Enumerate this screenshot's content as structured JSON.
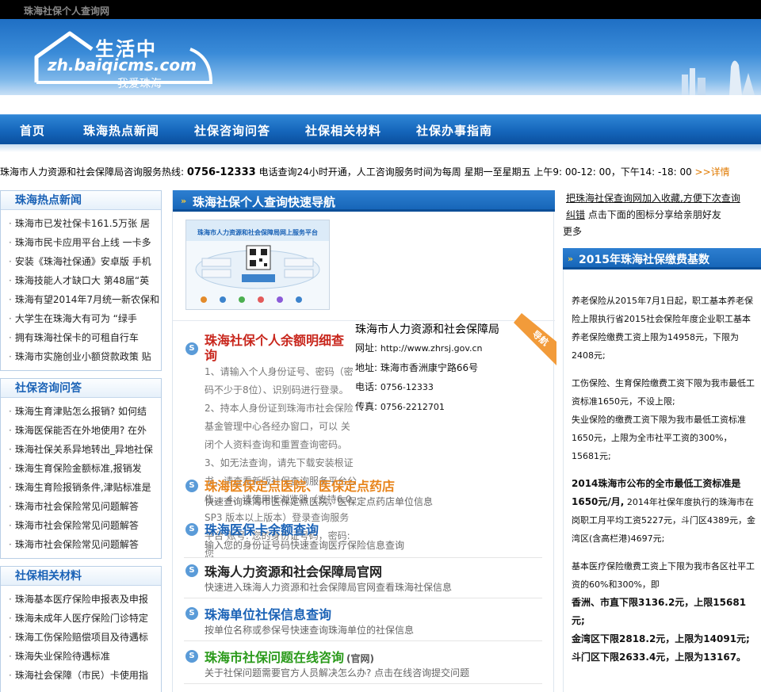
{
  "topbar": {
    "site_name": "珠海社保个人查询网"
  },
  "logo": {
    "top": "生活中",
    "url": "zh.baiqicms.com",
    "sub": "我爱珠海"
  },
  "nav": {
    "items": [
      "首页",
      "珠海热点新闻",
      "社保咨询问答",
      "社保相关材料",
      "社保办事指南"
    ]
  },
  "hotline": {
    "prefix": "珠海市人力资源和社会保障局咨询服务热线: ",
    "number": "0756-12333",
    "text": " 电话查询24小时开通，人工咨询服务时间为每周 星期一至星期五 上午9: 00-12: 00，下午14: -18: 00 ",
    "more": ">>详情"
  },
  "left": {
    "news": {
      "title": "珠海热点新闻",
      "items": [
        "珠海市已发社保卡161.5万张 居",
        "珠海市民卡应用平台上线 一卡多",
        "安装《珠海社保通》安卓版 手机",
        "珠海技能人才缺口大 第48届“英",
        "珠海有望2014年7月统一新农保和",
        "大学生在珠海大有可为 “绿手",
        "拥有珠海社保卡的可租自行车",
        "珠海市实施创业小额贷款政策 贴"
      ]
    },
    "qa": {
      "title": "社保咨询问答",
      "items": [
        "珠海生育津贴怎么报销? 如何结",
        "珠海医保能否在外地使用? 在外",
        "珠海社保关系异地转出_异地社保",
        "珠海生育保险金额标准,报销发",
        "珠海生育险报销条件,津贴标准是",
        "珠海市社会保险常见问题解答",
        "珠海市社会保险常见问题解答",
        "珠海市社会保险常见问题解答"
      ]
    },
    "materials": {
      "title": "社保相关材料",
      "items": [
        "珠海基本医疗保险申报表及申报",
        "珠海未成年人医疗保险门诊特定",
        "珠海工伤保险赔偿项目及待遇标",
        "珠海失业保险待遇标准",
        "珠海社会保障（市民）卡使用指"
      ]
    }
  },
  "mid": {
    "header": "珠海社保个人查询快速导航",
    "ribbon": "导航",
    "thumb_title": "珠海市人力资源和社会保障局网上服务平台",
    "balance": {
      "title": "珠海社保个人余额明细查询",
      "desc": "1、请输入个人身份证号、密码（密码不少于8位）、识别码进行登录。 2、持本人身份证到珠海市社会保险基金管理中心各经办窗口，可以 关闭个人资料查询和重置查询密码。 3、如无法查询，请先下载安装根证书，请查看新版社保查询服务平台公告。 4、请使用IE浏览器（支持6.0 SP3 版本以上版本）登录查询服务 平台 账号: 您的身份证号码，密码: 您"
    },
    "org": {
      "name": "珠海市人力资源和社会保障局",
      "website_label": "网址:",
      "website": "http://www.zhrsj.gov.cn",
      "address_label": "地址:",
      "address": "珠海市香洲康宁路66号",
      "phone_label": "电话:",
      "phone": "0756-12333",
      "fax_label": "传真:",
      "fax": "0756-2212701"
    },
    "entries": [
      {
        "title": "珠海医保定点医院、医保定点药店",
        "desc": "快速查询珠海市医保定点医院，医保定点药店单位信息",
        "color": "#e8851c"
      },
      {
        "title": "珠海医保卡余额查询",
        "desc": "输入您的身份证号码快速查询医疗保险信息查询",
        "color": "#1a62b6"
      },
      {
        "title": "珠海人力资源和社会保障局官网",
        "desc": "快速进入珠海人力资源和社会保障局官网查看珠海社保信息",
        "color": "#222222"
      },
      {
        "title": "珠海单位社保信息查询",
        "desc": "按单位名称或参保号快速查询珠海单位的社保信息",
        "color": "#1a62b6"
      },
      {
        "title": "珠海市社保问题在线咨询",
        "tag": "(官网)",
        "desc": "关于社保问题需要官方人员解决怎么办? 点击在线咨询提交问题",
        "color": "#2a9a1a"
      }
    ]
  },
  "right": {
    "bookmark": "把珠海社保查询网加入收藏,方便下次查询",
    "share_a": "纠错",
    "share_b": "点击下面的图标分享给亲朋好友",
    "share_c": "更多",
    "header": "2015年珠海社保缴费基数",
    "p1": "养老保险从2015年7月1日起，职工基本养老保险上限执行省2015社会保险年度企业职工基本养老保险缴费工资上限为14958元，下限为2408元;",
    "p2a": "工伤保险、生育保险缴费工资下限为我市最低工资标准1650元，不设上限;",
    "p2b": "失业保险的缴费工资下限为我市最低工资标准1650元，上限为全市社平工资的300%，15681元;",
    "p3_bold": "2014珠海市公布的全市最低工资标准是1650元/月,",
    "p3": " 2014年社保年度执行的珠海市在岗职工月平均工资5227元，斗门区4389元，金湾区(含高栏港)4697元;",
    "p4": "基本医疗保险缴费工资上下限为我市各区社平工资的60%和300%，即",
    "p4_xz": "香洲、市直下限3136.2元，上限15681元;",
    "p4_jw": "金湾区下限2818.2元，上限为14091元;",
    "p4_dm": "斗门区下限2633.4元，上限为13167。"
  }
}
